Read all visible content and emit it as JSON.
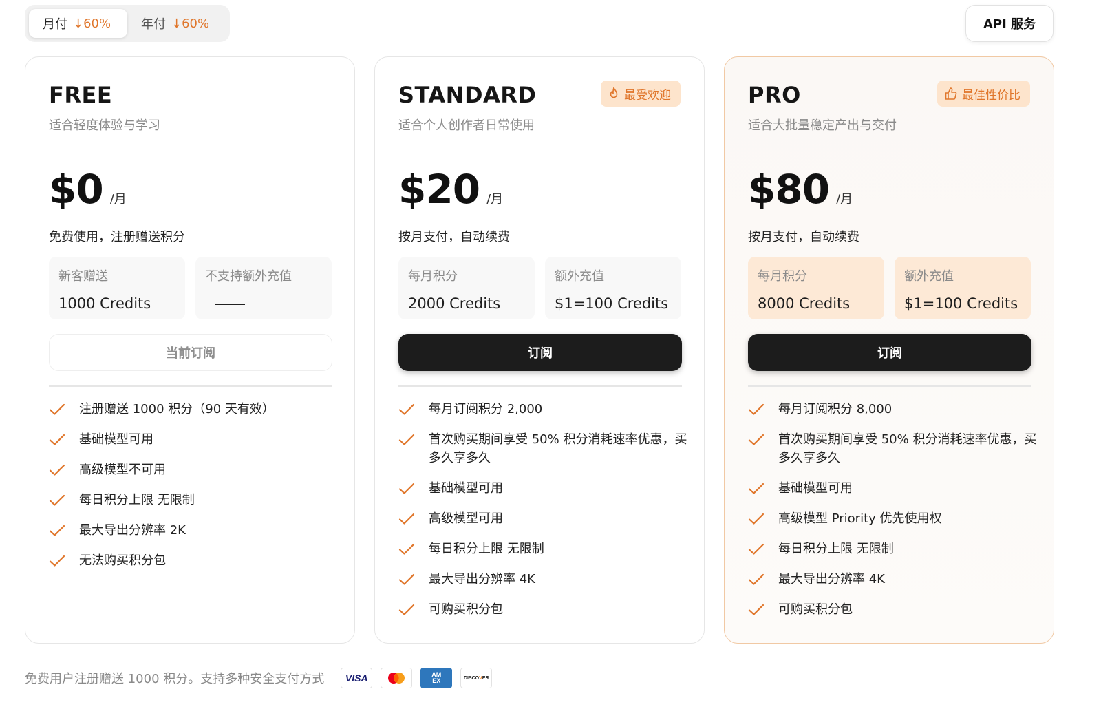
{
  "billing_toggle": {
    "monthly_label": "月付",
    "monthly_discount": "↓60%",
    "yearly_label": "年付",
    "yearly_discount": "↓60%",
    "selected": "monthly"
  },
  "api_button": {
    "label": "API 服务"
  },
  "plans": [
    {
      "name": "FREE",
      "subtitle": "适合轻度体验与学习",
      "price": "$0",
      "price_unit": "/月",
      "price_note": "免费使用，注册赠送积分",
      "box1": {
        "label": "新客赠送",
        "value": "1000 Credits"
      },
      "box2": {
        "label": "不支持额外充值",
        "value": ""
      },
      "cta": "当前订阅",
      "features": [
        "注册赠送 1000 积分（90 天有效）",
        "基础模型可用",
        "高级模型不可用",
        "每日积分上限 无限制",
        "最大导出分辨率 2K",
        "无法购买积分包"
      ]
    },
    {
      "name": "STANDARD",
      "subtitle": "适合个人创作者日常使用",
      "badge": "最受欢迎",
      "badge_icon": "flame-icon",
      "price": "$20",
      "price_unit": "/月",
      "price_note": "按月支付，自动续费",
      "box1": {
        "label": "每月积分",
        "value": "2000 Credits"
      },
      "box2": {
        "label": "额外充值",
        "value": "$1=100 Credits"
      },
      "cta": "订阅",
      "features": [
        "每月订阅积分 2,000",
        "首次购买期间享受 50% 积分消耗速率优惠，买多久享多久",
        "基础模型可用",
        "高级模型可用",
        "每日积分上限 无限制",
        "最大导出分辨率 4K",
        "可购买积分包"
      ]
    },
    {
      "name": "PRO",
      "subtitle": "适合大批量稳定产出与交付",
      "badge": "最佳性价比",
      "badge_icon": "thumbs-up-icon",
      "price": "$80",
      "price_unit": "/月",
      "price_note": "按月支付，自动续费",
      "box1": {
        "label": "每月积分",
        "value": "8000 Credits"
      },
      "box2": {
        "label": "额外充值",
        "value": "$1=100 Credits"
      },
      "cta": "订阅",
      "features": [
        "每月订阅积分 8,000",
        "首次购买期间享受 50% 积分消耗速率优惠，买多久享多久",
        "基础模型可用",
        "高级模型 Priority 优先使用权",
        "每日积分上限 无限制",
        "最大导出分辨率 4K",
        "可购买积分包"
      ]
    }
  ],
  "footer": {
    "text": "免费用户注册赠送 1000 积分。支持多种安全支付方式",
    "payment_methods": [
      "VISA",
      "Mastercard",
      "AMEX",
      "DISCOVER"
    ],
    "visa_text": "VISA",
    "amex_text": "AM EX",
    "discover_text": "DISCOVER"
  },
  "colors": {
    "accent": "#e0762b",
    "badge_bg": "#fde4cc",
    "cta_dark": "#1c1c1c"
  }
}
